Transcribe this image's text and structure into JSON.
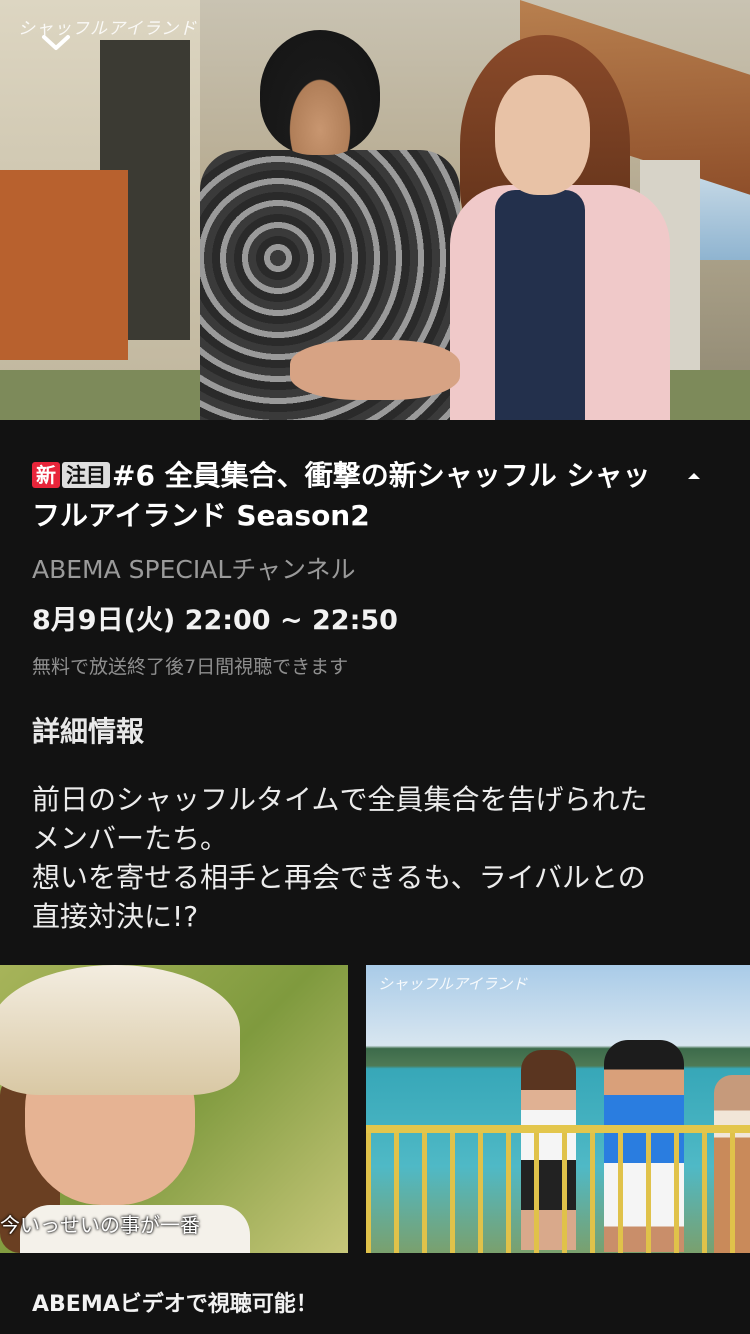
{
  "hero": {
    "logo_text": "シャッフルアイランド"
  },
  "program": {
    "badges": {
      "new": "新",
      "attention": "注目"
    },
    "title": "#6 全員集合、衝撃の新シャッフル シャッフルアイランド Season2",
    "channel": "ABEMA SPECIALチャンネル",
    "schedule": "8月9日(火) 22:00 ~ 22:50",
    "availability_note": "無料で放送終了後7日間視聴できます"
  },
  "details": {
    "heading": "詳細情報",
    "description_lines": [
      "前日のシャッフルタイムで全員集合を告げられた",
      "メンバーたち。",
      "想いを寄せる相手と再会できるも、ライバルとの",
      "直接対決に!?"
    ]
  },
  "thumbnails": [
    {
      "caption": "今いっせいの事が一番"
    },
    {
      "logo_text": "シャッフルアイランド"
    }
  ],
  "footer": {
    "text": "ABEMAビデオで視聴可能！"
  },
  "colors": {
    "background": "#121212",
    "new_badge": "#e8253a",
    "attention_badge": "#dedede"
  }
}
